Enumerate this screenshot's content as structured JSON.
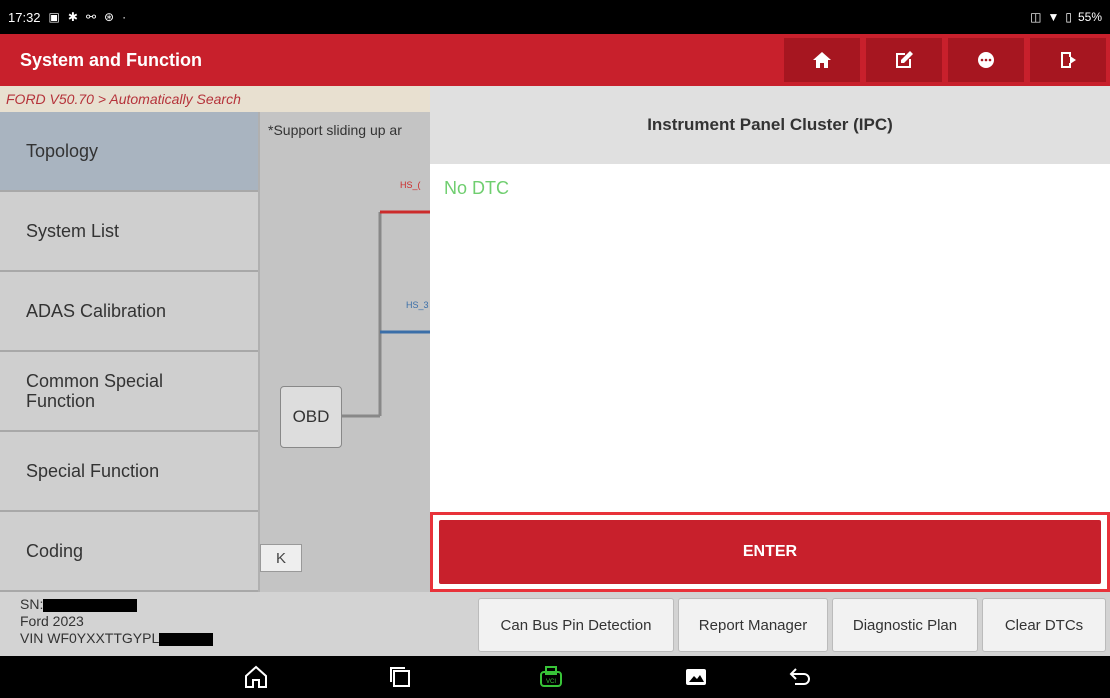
{
  "status": {
    "time": "17:32",
    "battery": "55%"
  },
  "header": {
    "title": "System and Function"
  },
  "breadcrumb": "FORD V50.70 > Automatically Search",
  "sidebar": {
    "items": [
      {
        "label": "Topology"
      },
      {
        "label": "System List"
      },
      {
        "label": "ADAS Calibration"
      },
      {
        "label": "Common Special Function"
      },
      {
        "label": "Special Function"
      },
      {
        "label": "Coding"
      }
    ]
  },
  "topology": {
    "hint": "*Support sliding up ar",
    "bus1": "HS_(",
    "bus2": "HS_3",
    "obd": "OBD",
    "collapse": "K"
  },
  "panel": {
    "title": "Instrument Panel Cluster (IPC)",
    "dtc_status": "No DTC",
    "enter": "ENTER",
    "dtc_color": "#6fce6f"
  },
  "vehicle": {
    "sn_label": "SN:",
    "model": "Ford  2023",
    "vin_label": "VIN WF0YXXTTGYPL"
  },
  "footer_buttons": [
    {
      "label": "Can Bus Pin Detection"
    },
    {
      "label": "Report Manager"
    },
    {
      "label": "Diagnostic Plan"
    },
    {
      "label": "Clear DTCs"
    }
  ],
  "colors": {
    "brand": "#c8202c",
    "active_sidebar": "#a9b4c0"
  }
}
